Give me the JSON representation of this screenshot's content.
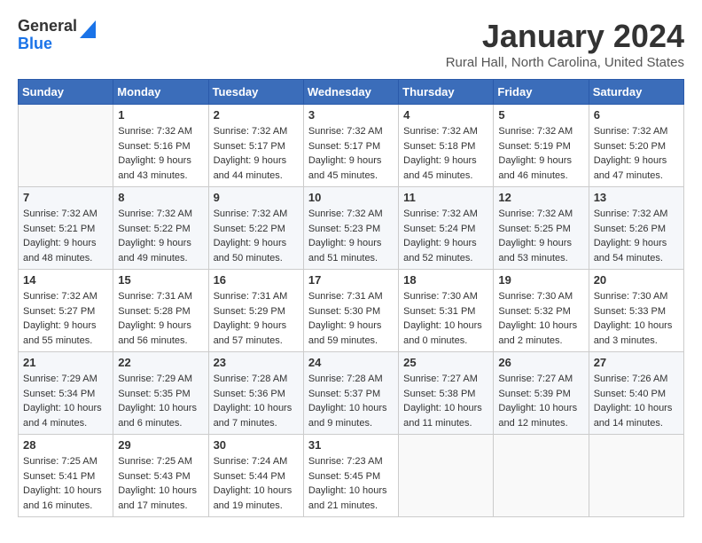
{
  "header": {
    "logo_line1": "General",
    "logo_line2": "Blue",
    "title": "January 2024",
    "location": "Rural Hall, North Carolina, United States"
  },
  "weekdays": [
    "Sunday",
    "Monday",
    "Tuesday",
    "Wednesday",
    "Thursday",
    "Friday",
    "Saturday"
  ],
  "weeks": [
    [
      {
        "day": "",
        "info": ""
      },
      {
        "day": "1",
        "info": "Sunrise: 7:32 AM\nSunset: 5:16 PM\nDaylight: 9 hours\nand 43 minutes."
      },
      {
        "day": "2",
        "info": "Sunrise: 7:32 AM\nSunset: 5:17 PM\nDaylight: 9 hours\nand 44 minutes."
      },
      {
        "day": "3",
        "info": "Sunrise: 7:32 AM\nSunset: 5:17 PM\nDaylight: 9 hours\nand 45 minutes."
      },
      {
        "day": "4",
        "info": "Sunrise: 7:32 AM\nSunset: 5:18 PM\nDaylight: 9 hours\nand 45 minutes."
      },
      {
        "day": "5",
        "info": "Sunrise: 7:32 AM\nSunset: 5:19 PM\nDaylight: 9 hours\nand 46 minutes."
      },
      {
        "day": "6",
        "info": "Sunrise: 7:32 AM\nSunset: 5:20 PM\nDaylight: 9 hours\nand 47 minutes."
      }
    ],
    [
      {
        "day": "7",
        "info": "Sunrise: 7:32 AM\nSunset: 5:21 PM\nDaylight: 9 hours\nand 48 minutes."
      },
      {
        "day": "8",
        "info": "Sunrise: 7:32 AM\nSunset: 5:22 PM\nDaylight: 9 hours\nand 49 minutes."
      },
      {
        "day": "9",
        "info": "Sunrise: 7:32 AM\nSunset: 5:22 PM\nDaylight: 9 hours\nand 50 minutes."
      },
      {
        "day": "10",
        "info": "Sunrise: 7:32 AM\nSunset: 5:23 PM\nDaylight: 9 hours\nand 51 minutes."
      },
      {
        "day": "11",
        "info": "Sunrise: 7:32 AM\nSunset: 5:24 PM\nDaylight: 9 hours\nand 52 minutes."
      },
      {
        "day": "12",
        "info": "Sunrise: 7:32 AM\nSunset: 5:25 PM\nDaylight: 9 hours\nand 53 minutes."
      },
      {
        "day": "13",
        "info": "Sunrise: 7:32 AM\nSunset: 5:26 PM\nDaylight: 9 hours\nand 54 minutes."
      }
    ],
    [
      {
        "day": "14",
        "info": "Sunrise: 7:32 AM\nSunset: 5:27 PM\nDaylight: 9 hours\nand 55 minutes."
      },
      {
        "day": "15",
        "info": "Sunrise: 7:31 AM\nSunset: 5:28 PM\nDaylight: 9 hours\nand 56 minutes."
      },
      {
        "day": "16",
        "info": "Sunrise: 7:31 AM\nSunset: 5:29 PM\nDaylight: 9 hours\nand 57 minutes."
      },
      {
        "day": "17",
        "info": "Sunrise: 7:31 AM\nSunset: 5:30 PM\nDaylight: 9 hours\nand 59 minutes."
      },
      {
        "day": "18",
        "info": "Sunrise: 7:30 AM\nSunset: 5:31 PM\nDaylight: 10 hours\nand 0 minutes."
      },
      {
        "day": "19",
        "info": "Sunrise: 7:30 AM\nSunset: 5:32 PM\nDaylight: 10 hours\nand 2 minutes."
      },
      {
        "day": "20",
        "info": "Sunrise: 7:30 AM\nSunset: 5:33 PM\nDaylight: 10 hours\nand 3 minutes."
      }
    ],
    [
      {
        "day": "21",
        "info": "Sunrise: 7:29 AM\nSunset: 5:34 PM\nDaylight: 10 hours\nand 4 minutes."
      },
      {
        "day": "22",
        "info": "Sunrise: 7:29 AM\nSunset: 5:35 PM\nDaylight: 10 hours\nand 6 minutes."
      },
      {
        "day": "23",
        "info": "Sunrise: 7:28 AM\nSunset: 5:36 PM\nDaylight: 10 hours\nand 7 minutes."
      },
      {
        "day": "24",
        "info": "Sunrise: 7:28 AM\nSunset: 5:37 PM\nDaylight: 10 hours\nand 9 minutes."
      },
      {
        "day": "25",
        "info": "Sunrise: 7:27 AM\nSunset: 5:38 PM\nDaylight: 10 hours\nand 11 minutes."
      },
      {
        "day": "26",
        "info": "Sunrise: 7:27 AM\nSunset: 5:39 PM\nDaylight: 10 hours\nand 12 minutes."
      },
      {
        "day": "27",
        "info": "Sunrise: 7:26 AM\nSunset: 5:40 PM\nDaylight: 10 hours\nand 14 minutes."
      }
    ],
    [
      {
        "day": "28",
        "info": "Sunrise: 7:25 AM\nSunset: 5:41 PM\nDaylight: 10 hours\nand 16 minutes."
      },
      {
        "day": "29",
        "info": "Sunrise: 7:25 AM\nSunset: 5:43 PM\nDaylight: 10 hours\nand 17 minutes."
      },
      {
        "day": "30",
        "info": "Sunrise: 7:24 AM\nSunset: 5:44 PM\nDaylight: 10 hours\nand 19 minutes."
      },
      {
        "day": "31",
        "info": "Sunrise: 7:23 AM\nSunset: 5:45 PM\nDaylight: 10 hours\nand 21 minutes."
      },
      {
        "day": "",
        "info": ""
      },
      {
        "day": "",
        "info": ""
      },
      {
        "day": "",
        "info": ""
      }
    ]
  ]
}
